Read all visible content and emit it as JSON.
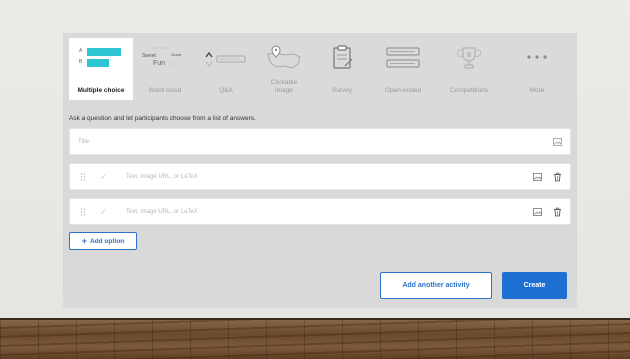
{
  "tabs": [
    {
      "label": "Multiple choice",
      "icon": "multiple-choice-icon",
      "active": true
    },
    {
      "label": "Word cloud",
      "icon": "word-cloud-icon",
      "active": false
    },
    {
      "label": "Q&A",
      "icon": "qa-icon",
      "active": false
    },
    {
      "label": "Clickable\nimage",
      "icon": "map-pin-icon",
      "active": false
    },
    {
      "label": "Survey",
      "icon": "clipboard-icon",
      "active": false
    },
    {
      "label": "Open-ended",
      "icon": "text-lines-icon",
      "active": false
    },
    {
      "label": "Competitions",
      "icon": "trophy-icon",
      "active": false
    },
    {
      "label": "More",
      "icon": "more-icon",
      "active": false
    }
  ],
  "mc_icon_letters": [
    "A",
    "B"
  ],
  "word_cloud_words": [
    "Sweet",
    "Fun",
    "Great",
    "Cool",
    "Awesome"
  ],
  "hint": "Ask a question and let participants choose from a list of answers.",
  "title_field": {
    "placeholder": "Title"
  },
  "options": [
    {
      "placeholder": "Text, image URL, or LaTeX"
    },
    {
      "placeholder": "Text, image URL, or LaTeX"
    }
  ],
  "add_option_label": "Add option",
  "add_activity_label": "Add another activity",
  "create_label": "Create",
  "colors": {
    "accent": "#1d6fd1",
    "mc_bars": "#2fc5d3"
  }
}
